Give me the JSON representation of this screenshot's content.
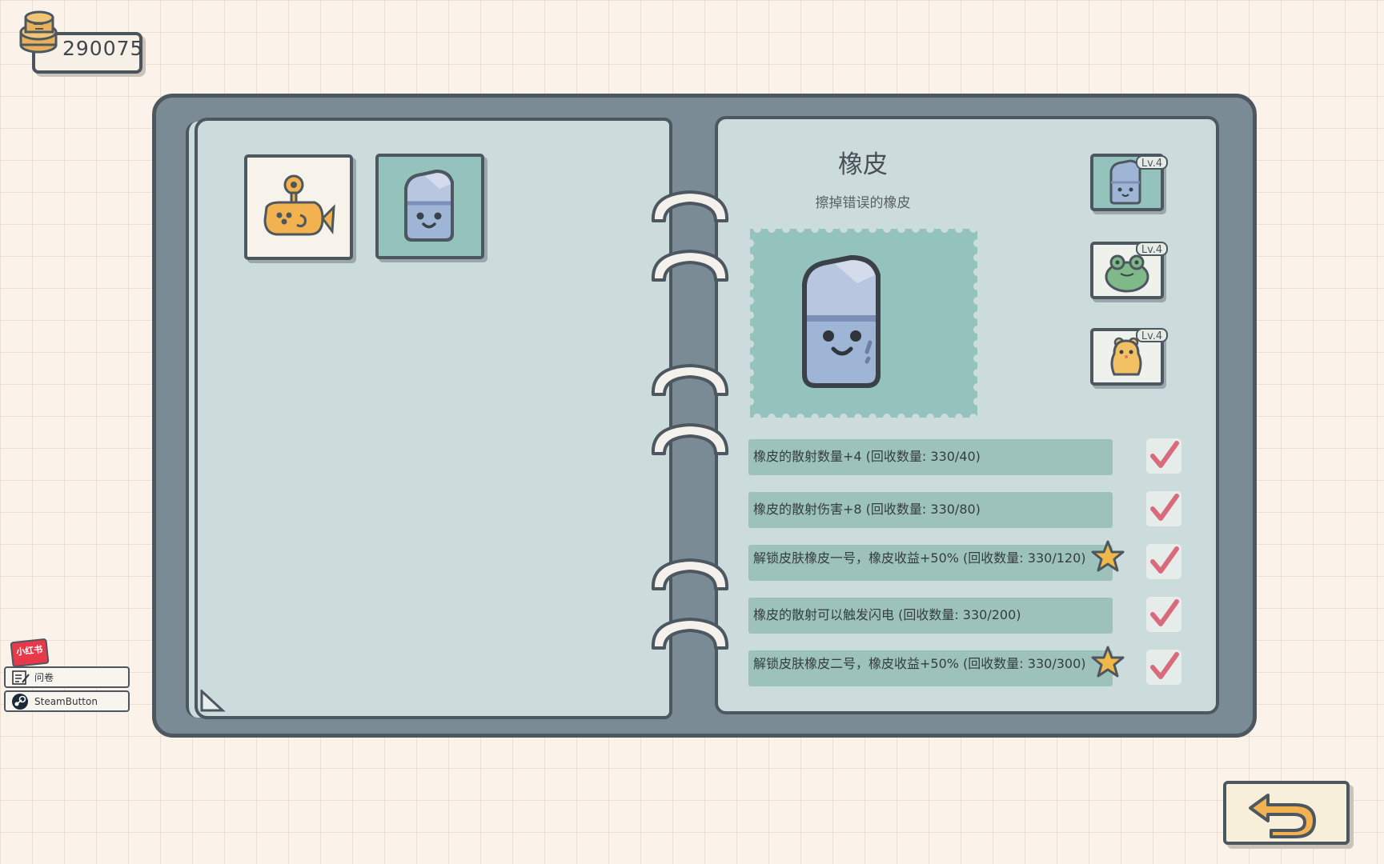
{
  "hud": {
    "coins": "290075"
  },
  "collection": {
    "items": [
      {
        "name": "fish-robot",
        "selected": false,
        "bg": "#f7f3ea"
      },
      {
        "name": "eraser",
        "selected": true,
        "bg": "#94c2bc"
      }
    ]
  },
  "detail": {
    "title": "橡皮",
    "description": "擦掉错误的橡皮",
    "skins": [
      {
        "level": "Lv.4",
        "icon": "eraser-icon"
      },
      {
        "level": "Lv.4",
        "icon": "frog-icon"
      },
      {
        "level": "Lv.4",
        "icon": "hamster-icon"
      }
    ],
    "upgrades": [
      {
        "text": "橡皮的散射数量+4 (回收数量: 330/40)",
        "star": false,
        "checked": true
      },
      {
        "text": "橡皮的散射伤害+8 (回收数量: 330/80)",
        "star": false,
        "checked": true
      },
      {
        "text": "解锁皮肤橡皮一号，橡皮收益+50% (回收数量: 330/120)",
        "star": true,
        "checked": true
      },
      {
        "text": "橡皮的散射可以触发闪电 (回收数量: 330/200)",
        "star": false,
        "checked": true
      },
      {
        "text": "解锁皮肤橡皮二号，橡皮收益+50% (回收数量: 330/300)",
        "star": true,
        "checked": true
      }
    ]
  },
  "side_buttons": {
    "logo_text": "小红书",
    "survey": "问卷",
    "steam": "SteamButton"
  },
  "colors": {
    "book_frame": "#7a8b96",
    "page": "#ccdcdc",
    "bar": "#9cc2bb",
    "check": "#d96a7c",
    "star": "#f0b84a"
  }
}
